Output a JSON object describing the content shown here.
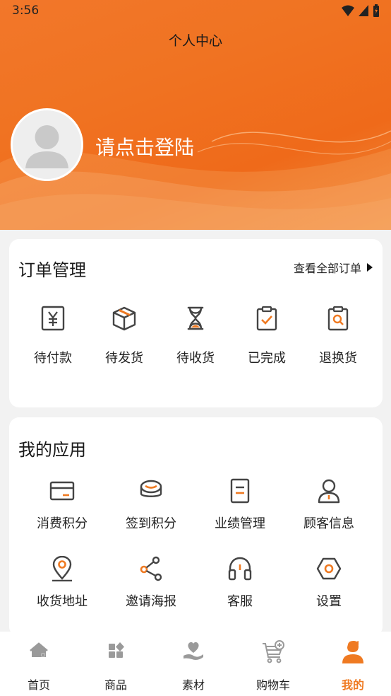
{
  "status": {
    "time": "3:56"
  },
  "header": {
    "title": "个人中心",
    "login_prompt": "请点击登陆"
  },
  "orders": {
    "title": "订单管理",
    "view_all": "查看全部订单",
    "items": [
      {
        "label": "待付款",
        "icon": "yen-payment-icon"
      },
      {
        "label": "待发货",
        "icon": "package-icon"
      },
      {
        "label": "待收货",
        "icon": "hourglass-icon"
      },
      {
        "label": "已完成",
        "icon": "clipboard-check-icon"
      },
      {
        "label": "退换货",
        "icon": "clipboard-search-icon"
      }
    ]
  },
  "apps": {
    "title": "我的应用",
    "items": [
      {
        "label": "消费积分",
        "icon": "card-icon"
      },
      {
        "label": "签到积分",
        "icon": "coins-icon"
      },
      {
        "label": "业绩管理",
        "icon": "document-icon"
      },
      {
        "label": "顾客信息",
        "icon": "user-icon"
      },
      {
        "label": "收货地址",
        "icon": "location-pin-icon"
      },
      {
        "label": "邀请海报",
        "icon": "share-icon"
      },
      {
        "label": "客服",
        "icon": "headset-icon"
      },
      {
        "label": "设置",
        "icon": "settings-hex-icon"
      }
    ]
  },
  "tabbar": {
    "items": [
      {
        "label": "首页",
        "icon": "home-icon"
      },
      {
        "label": "商品",
        "icon": "grid-icon"
      },
      {
        "label": "素材",
        "icon": "heart-hand-icon"
      },
      {
        "label": "购物车",
        "icon": "cart-icon"
      },
      {
        "label": "我的",
        "icon": "profile-icon"
      }
    ],
    "active": "我的"
  },
  "colors": {
    "accent": "#ef7a22",
    "icon_gray": "#444444",
    "background": "#f2f2f2"
  }
}
